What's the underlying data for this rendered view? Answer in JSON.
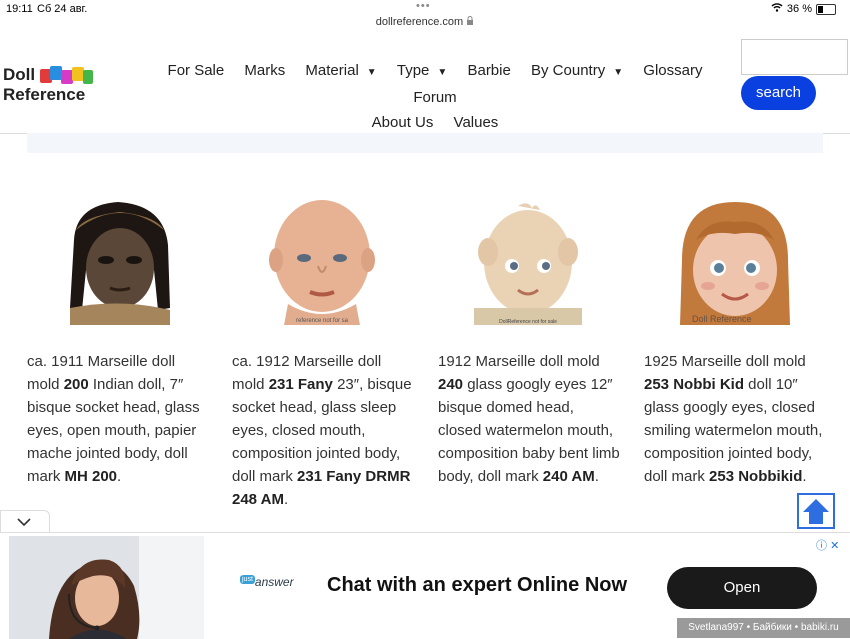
{
  "status_bar": {
    "time": "19:11",
    "date": "Сб 24 авг.",
    "url": "dollreference.com",
    "battery": "36 %",
    "battery_level": 0.36
  },
  "logo": {
    "line1": "Doll",
    "line2": "Reference",
    "colors": [
      "#e23b3b",
      "#2a8ee0",
      "#d63bc7",
      "#f2c11d",
      "#43b649"
    ]
  },
  "nav": {
    "items": [
      {
        "label": "For Sale",
        "has_dropdown": false
      },
      {
        "label": "Marks",
        "has_dropdown": false
      },
      {
        "label": "Material",
        "has_dropdown": true
      },
      {
        "label": "Type",
        "has_dropdown": true
      },
      {
        "label": "Barbie",
        "has_dropdown": false
      },
      {
        "label": "By Country",
        "has_dropdown": true
      },
      {
        "label": "Glossary",
        "has_dropdown": false
      },
      {
        "label": "Forum",
        "has_dropdown": false
      },
      {
        "label": "About Us",
        "has_dropdown": false
      },
      {
        "label": "Values",
        "has_dropdown": false
      }
    ],
    "caret": "▼"
  },
  "search": {
    "placeholder": "",
    "button_label": "search",
    "button_color": "#0a3fe0"
  },
  "dolls": [
    {
      "watermark": "",
      "caption": [
        [
          "ca. 1911 Marseille doll mold ",
          false
        ],
        [
          "200",
          true
        ],
        [
          " Indian doll, 7″ bisque socket head, glass eyes, open mouth, papier mache jointed body, doll mark ",
          false
        ],
        [
          "MH 200",
          true
        ],
        [
          ".",
          false
        ]
      ]
    },
    {
      "watermark": "reference not for sa",
      "caption": [
        [
          "ca. 1912 Marseille doll mold ",
          false
        ],
        [
          "231 Fany",
          true
        ],
        [
          " 23″, bisque socket head, glass sleep eyes, closed mouth, composition jointed body, doll mark ",
          false
        ],
        [
          "231 Fany DRMR 248 AM",
          true
        ],
        [
          ".",
          false
        ]
      ]
    },
    {
      "watermark": "DollReference not for sale",
      "caption": [
        [
          "1912 Marseille doll mold ",
          false
        ],
        [
          "240",
          true
        ],
        [
          " glass googly eyes 12″ bisque domed head, closed watermelon mouth, composition baby bent limb body, doll mark ",
          false
        ],
        [
          "240 AM",
          true
        ],
        [
          ".",
          false
        ]
      ]
    },
    {
      "watermark": "Doll Reference",
      "caption": [
        [
          "1925 Marseille doll mold ",
          false
        ],
        [
          "253 Nobbi Kid",
          true
        ],
        [
          " doll 10″ glass googly eyes, closed smiling watermelon mouth, composition jointed body, doll mark ",
          false
        ],
        [
          "253 Nobbikid",
          true
        ],
        [
          ".",
          false
        ]
      ]
    }
  ],
  "ad": {
    "logo_small": "just",
    "logo_text": "answer",
    "headline": "Chat with an expert Online Now",
    "cta": "Open"
  },
  "watermark_text": "Svetlana997 • Байбики • babiki.ru"
}
